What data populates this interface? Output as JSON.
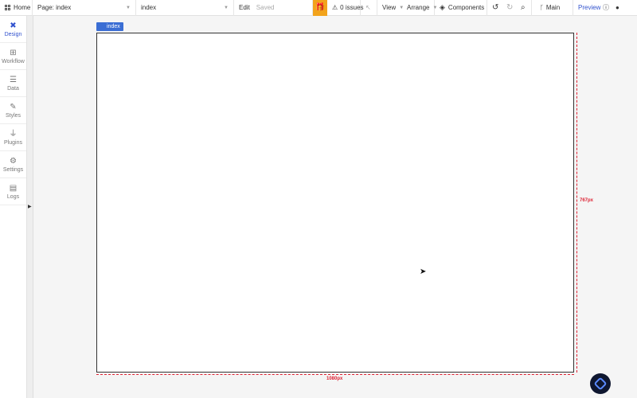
{
  "topbar": {
    "home_label": "Home",
    "page_label": "Page: index",
    "element_value": "index",
    "edit_label": "Edit",
    "saved_label": "Saved",
    "issues_label": "0 issues",
    "view_label": "View",
    "arrange_label": "Arrange",
    "components_label": "Components",
    "branch_label": "Main",
    "preview_label": "Preview"
  },
  "sidebar": {
    "items": [
      {
        "label": "Design"
      },
      {
        "label": "Workflow"
      },
      {
        "label": "Data"
      },
      {
        "label": "Styles"
      },
      {
        "label": "Plugins"
      },
      {
        "label": "Settings"
      },
      {
        "label": "Logs"
      }
    ]
  },
  "canvas": {
    "page_tag": "index",
    "height_label": "767px",
    "width_label": "1080px"
  }
}
